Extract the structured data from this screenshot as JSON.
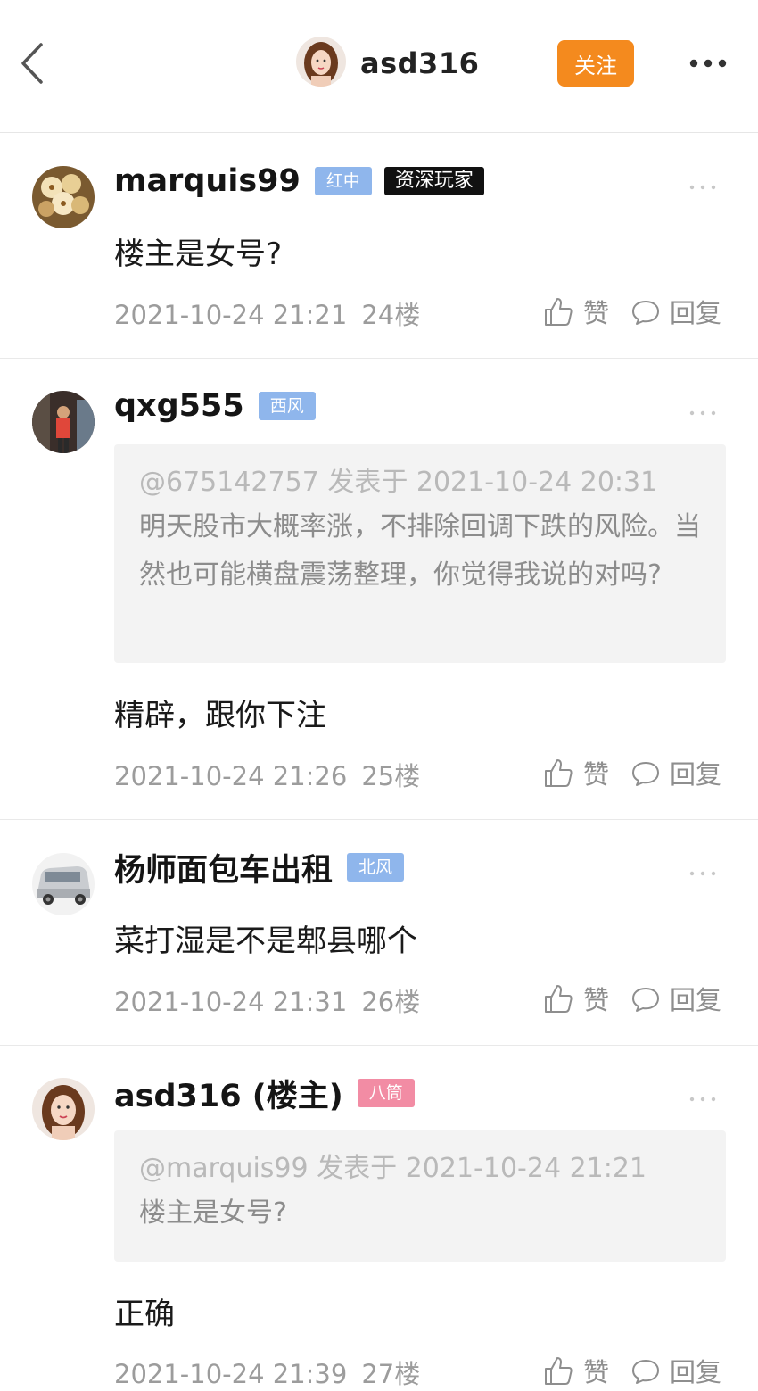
{
  "header": {
    "username": "asd316",
    "follow_label": "关注"
  },
  "actions": {
    "like_label": "赞",
    "reply_label": "回复"
  },
  "posts": [
    {
      "username": "marquis99",
      "badges": [
        "红中",
        "资深玩家"
      ],
      "content": "楼主是女号?",
      "time": "2021-10-24 21:21",
      "floor": "24楼"
    },
    {
      "username": "qxg555",
      "badges": [
        "西风"
      ],
      "quote_head": "@675142757 发表于 2021-10-24 20:31",
      "quote_text": "明天股市大概率涨，不排除回调下跌的风险。当然也可能横盘震荡整理，你觉得我说的对吗?",
      "content": "精辟，跟你下注",
      "time": "2021-10-24 21:26",
      "floor": "25楼"
    },
    {
      "username": "杨师面包车出租",
      "badges": [
        "北风"
      ],
      "content": "菜打湿是不是郫县哪个",
      "time": "2021-10-24 21:31",
      "floor": "26楼"
    },
    {
      "username": "asd316 (楼主)",
      "badges": [
        "八筒"
      ],
      "quote_head": "@marquis99 发表于 2021-10-24 21:21",
      "quote_text": "楼主是女号?",
      "content": "正确",
      "time": "2021-10-24 21:39",
      "floor": "27楼"
    }
  ]
}
